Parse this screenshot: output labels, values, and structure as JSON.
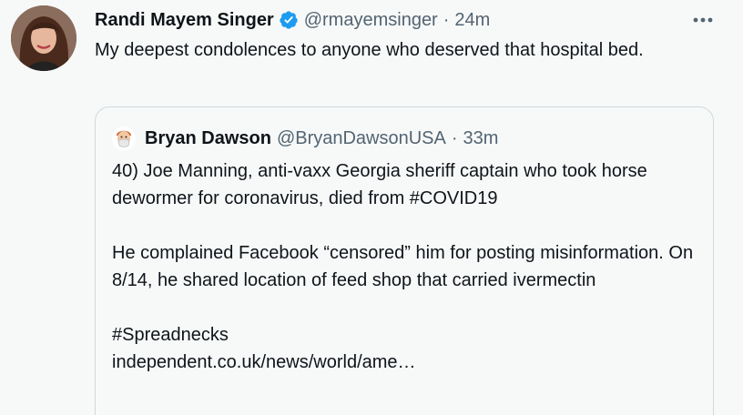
{
  "tweet": {
    "author_name": "Randi Mayem Singer",
    "author_handle": "@rmayemsinger",
    "separator": "·",
    "time": "24m",
    "text": "My deepest condolences to anyone who deserved that hospital bed.",
    "more_icon": "more-horizontal-icon",
    "verified_icon": "verified-badge-icon",
    "verified_color": "#1d9bf0"
  },
  "quote": {
    "author_name": "Bryan Dawson",
    "author_handle": "@BryanDawsonUSA",
    "separator": "·",
    "time": "33m",
    "paragraphs": [
      "40) Joe Manning, anti-vaxx Georgia sheriff captain who took horse dewormer for coronavirus, died from #COVID19",
      "He complained Facebook “censored” him for posting misinformation. On 8/14, he shared location of feed shop that carried ivermectin",
      "#Spreadnecks",
      "independent.co.uk/news/world/ame…"
    ]
  },
  "colors": {
    "background": "#f7f9f9",
    "text": "#0f1419",
    "secondary": "#536471",
    "border": "#cfd9de",
    "accent": "#1d9bf0"
  }
}
